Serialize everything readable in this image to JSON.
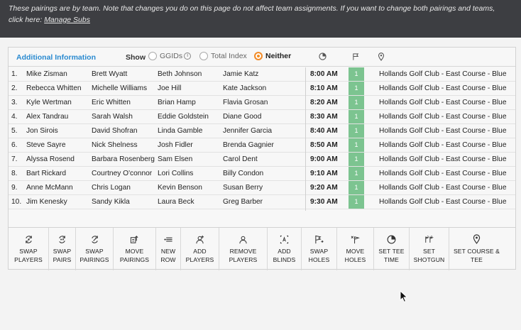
{
  "banner": {
    "text": "These pairings are by team. Note that changes you do on this page do not affect team assignments. If you want to change both pairings and teams,",
    "text2": "click here: ",
    "link": "Manage Subs"
  },
  "header": {
    "additional_info": "Additional Information",
    "show_label": "Show",
    "options": [
      "GGIDs",
      "Total Index",
      "Neither"
    ],
    "selected": "Neither"
  },
  "rows": [
    {
      "num": "1.",
      "players": [
        "Mike Zisman",
        "Brett Wyatt",
        "Beth Johnson",
        "Jamie Katz"
      ],
      "time": "8:00 AM",
      "hole": "1",
      "course": "Hollands Golf Club - East Course - Blue"
    },
    {
      "num": "2.",
      "players": [
        "Rebecca Whitten",
        "Michelle Williams",
        "Joe Hill",
        "Kate Jackson"
      ],
      "time": "8:10 AM",
      "hole": "1",
      "course": "Hollands Golf Club - East Course - Blue"
    },
    {
      "num": "3.",
      "players": [
        "Kyle Wertman",
        "Eric Whitten",
        "Brian Hamp",
        "Flavia Grosan"
      ],
      "time": "8:20 AM",
      "hole": "1",
      "course": "Hollands Golf Club - East Course - Blue"
    },
    {
      "num": "4.",
      "players": [
        "Alex Tandrau",
        "Sarah Walsh",
        "Eddie Goldstein",
        "Diane Good"
      ],
      "time": "8:30 AM",
      "hole": "1",
      "course": "Hollands Golf Club - East Course - Blue"
    },
    {
      "num": "5.",
      "players": [
        "Jon Sirois",
        "David Shofran",
        "Linda Gamble",
        "Jennifer Garcia"
      ],
      "time": "8:40 AM",
      "hole": "1",
      "course": "Hollands Golf Club - East Course - Blue"
    },
    {
      "num": "6.",
      "players": [
        "Steve Sayre",
        "Nick Shelness",
        "Josh Fidler",
        "Brenda Gagnier"
      ],
      "time": "8:50 AM",
      "hole": "1",
      "course": "Hollands Golf Club - East Course - Blue"
    },
    {
      "num": "7.",
      "players": [
        "Alyssa Rosend",
        "Barbara Rosenberg",
        "Sam Elsen",
        "Carol Dent"
      ],
      "time": "9:00 AM",
      "hole": "1",
      "course": "Hollands Golf Club - East Course - Blue"
    },
    {
      "num": "8.",
      "players": [
        "Bart Rickard",
        "Courtney O'connor",
        "Lori Collins",
        "Billy Condon"
      ],
      "time": "9:10 AM",
      "hole": "1",
      "course": "Hollands Golf Club - East Course - Blue"
    },
    {
      "num": "9.",
      "players": [
        "Anne McMann",
        "Chris Logan",
        "Kevin Benson",
        "Susan Berry"
      ],
      "time": "9:20 AM",
      "hole": "1",
      "course": "Hollands Golf Club - East Course - Blue"
    },
    {
      "num": "10.",
      "players": [
        "Jim Kenesky",
        "Sandy Kikla",
        "Laura Beck",
        "Greg Barber"
      ],
      "time": "9:30 AM",
      "hole": "1",
      "course": "Hollands Golf Club - East Course - Blue"
    }
  ],
  "toolbar": [
    {
      "line1": "SWAP",
      "line2": "PLAYERS",
      "icon": "swap-players-icon"
    },
    {
      "line1": "SWAP",
      "line2": "PAIRS",
      "icon": "swap-pairs-icon"
    },
    {
      "line1": "SWAP",
      "line2": "PAIRINGS",
      "icon": "swap-pairings-icon"
    },
    {
      "line1": "MOVE",
      "line2": "PAIRINGS",
      "icon": "move-pairings-icon"
    },
    {
      "line1": "NEW",
      "line2": "ROW",
      "icon": "new-row-icon"
    },
    {
      "line1": "ADD",
      "line2": "PLAYERS",
      "icon": "add-player-icon"
    },
    {
      "line1": "REMOVE",
      "line2": "PLAYERS",
      "icon": "remove-player-icon"
    },
    {
      "line1": "ADD",
      "line2": "BLINDS",
      "icon": "add-blinds-icon"
    },
    {
      "line1": "SWAP",
      "line2": "HOLES",
      "icon": "swap-holes-icon"
    },
    {
      "line1": "MOVE",
      "line2": "HOLES",
      "icon": "move-holes-icon"
    },
    {
      "line1": "SET TEE",
      "line2": "TIME",
      "icon": "clock-icon"
    },
    {
      "line1": "SET",
      "line2": "SHOTGUN",
      "icon": "shotgun-icon"
    },
    {
      "line1": "SET COURSE &",
      "line2": "TEE",
      "icon": "location-pin-icon"
    }
  ],
  "colors": {
    "banner_bg": "#3d3e42",
    "accent_blue": "#2a8ad0",
    "hole_green": "#7cc490",
    "radio_orange": "#f58d1f"
  }
}
